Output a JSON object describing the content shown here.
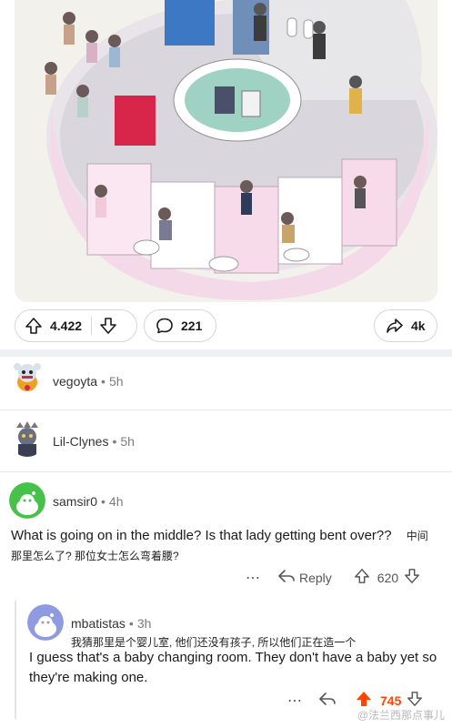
{
  "post": {
    "upvotes": "4.422",
    "comments": "221",
    "share": "4k"
  },
  "comments": [
    {
      "author": "vegoyta",
      "time": "5h"
    },
    {
      "author": "Lil-Clynes",
      "time": "5h"
    },
    {
      "author": "samsir0",
      "time": "4h",
      "body": "What is going on in the middle?  Is that lady getting bent over??",
      "translation": "中间那里怎么了? 那位女士怎么弯着腰?",
      "reply_label": "Reply",
      "score": "620"
    }
  ],
  "reply": {
    "author": "mbatistas",
    "time": "3h",
    "translation": "我猜那里是个婴儿室, 他们还没有孩子, 所以他们正在造一个",
    "body": "I guess that's a baby changing room. They don't have a baby yet so they're making one.",
    "score": "745"
  },
  "watermark": "@法兰西那点事儿",
  "colors": {
    "upvote_active": "#ff4500",
    "score_active": "#ff4500",
    "border": "#d4d6d8"
  },
  "icons": [
    "upvote-icon",
    "downvote-icon",
    "comment-icon",
    "share-icon",
    "more-icon",
    "reply-icon"
  ]
}
